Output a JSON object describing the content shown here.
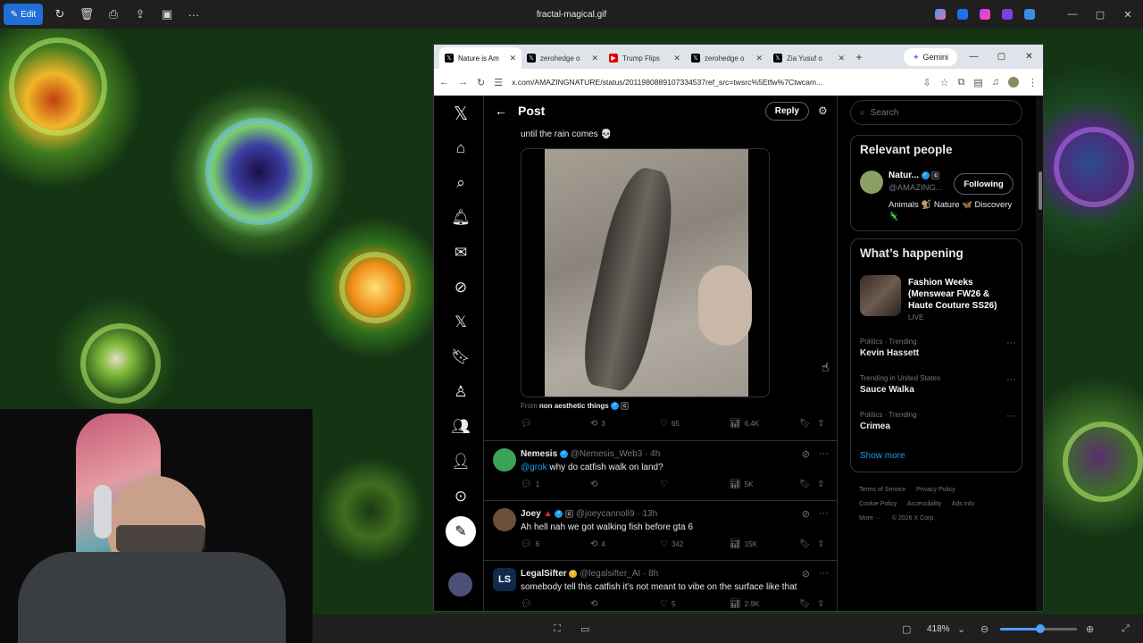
{
  "photos_app": {
    "edit_label": "Edit",
    "file_title": "fractal-magical.gif",
    "zoom_level": "418%"
  },
  "browser": {
    "tabs": [
      {
        "label": "Nature is Am",
        "favicon": "x-icon",
        "active": true
      },
      {
        "label": "zerohedge o",
        "favicon": "x-icon",
        "active": false
      },
      {
        "label": "Trump Flips",
        "favicon": "youtube-icon",
        "active": false
      },
      {
        "label": "zerohedge o",
        "favicon": "x-icon",
        "active": false
      },
      {
        "label": "Zia Yusuf o",
        "favicon": "x-icon",
        "active": false
      }
    ],
    "gemini_label": "Gemini",
    "url": "x.com/AMAZINGNATURE/status/2011980889107334537ref_src=twsrc%5Etfw%7Ctwcam..."
  },
  "header": {
    "title": "Post",
    "reply_label": "Reply"
  },
  "main_post": {
    "text": "until the rain comes 💀",
    "from_prefix": "From",
    "from_account": "non aesthetic things",
    "stats": {
      "replies": "",
      "reposts": "3",
      "likes": "65",
      "views": "6.4K"
    }
  },
  "replies": [
    {
      "name": "Nemesis",
      "handle": "@Nemesis_Web3",
      "time": "4h",
      "mention": "@grok",
      "text": " why do catfish walk on land?",
      "stats": {
        "replies": "1",
        "reposts": "",
        "likes": "",
        "views": "5K"
      },
      "avatar_color": "#3aa35a"
    },
    {
      "name": "Joey",
      "handle": "@joeycannoli9",
      "time": "13h",
      "mention": "",
      "text": "Ah hell nah we got walking fish before gta 6",
      "stats": {
        "replies": "6",
        "reposts": "4",
        "likes": "342",
        "views": "15K"
      },
      "avatar_color": "#6a4f3a"
    },
    {
      "name": "LegalSifter",
      "handle": "@legalsifter_AI",
      "time": "8h",
      "mention": "",
      "text": "somebody tell this catfish it’s not meant to vibe on the surface like that",
      "stats": {
        "replies": "",
        "reposts": "",
        "likes": "5",
        "views": "2.9K"
      },
      "avatar_color": "#0f2a4a"
    }
  ],
  "sidebar": {
    "search_placeholder": "Search",
    "relevant_title": "Relevant people",
    "person": {
      "name": "Natur...",
      "handle": "@AMAZING...",
      "following_label": "Following",
      "bio": "Animals 🐒 Nature 🦋 Discovery 🦎"
    },
    "happening_title": "What’s happening",
    "featured": {
      "title": "Fashion Weeks (Menswear FW26 & Haute Couture SS26)",
      "live": "LIVE"
    },
    "trends": [
      {
        "category": "Politics · Trending",
        "name": "Kevin Hassett"
      },
      {
        "category": "Trending in United States",
        "name": "Sauce Walka"
      },
      {
        "category": "Politics · Trending",
        "name": "Crimea"
      }
    ],
    "show_more": "Show more",
    "footer": [
      "Terms of Service",
      "Privacy Policy",
      "Cookie Policy",
      "Accessibility",
      "Ads info",
      "More ···",
      "© 2026 X Corp."
    ]
  }
}
